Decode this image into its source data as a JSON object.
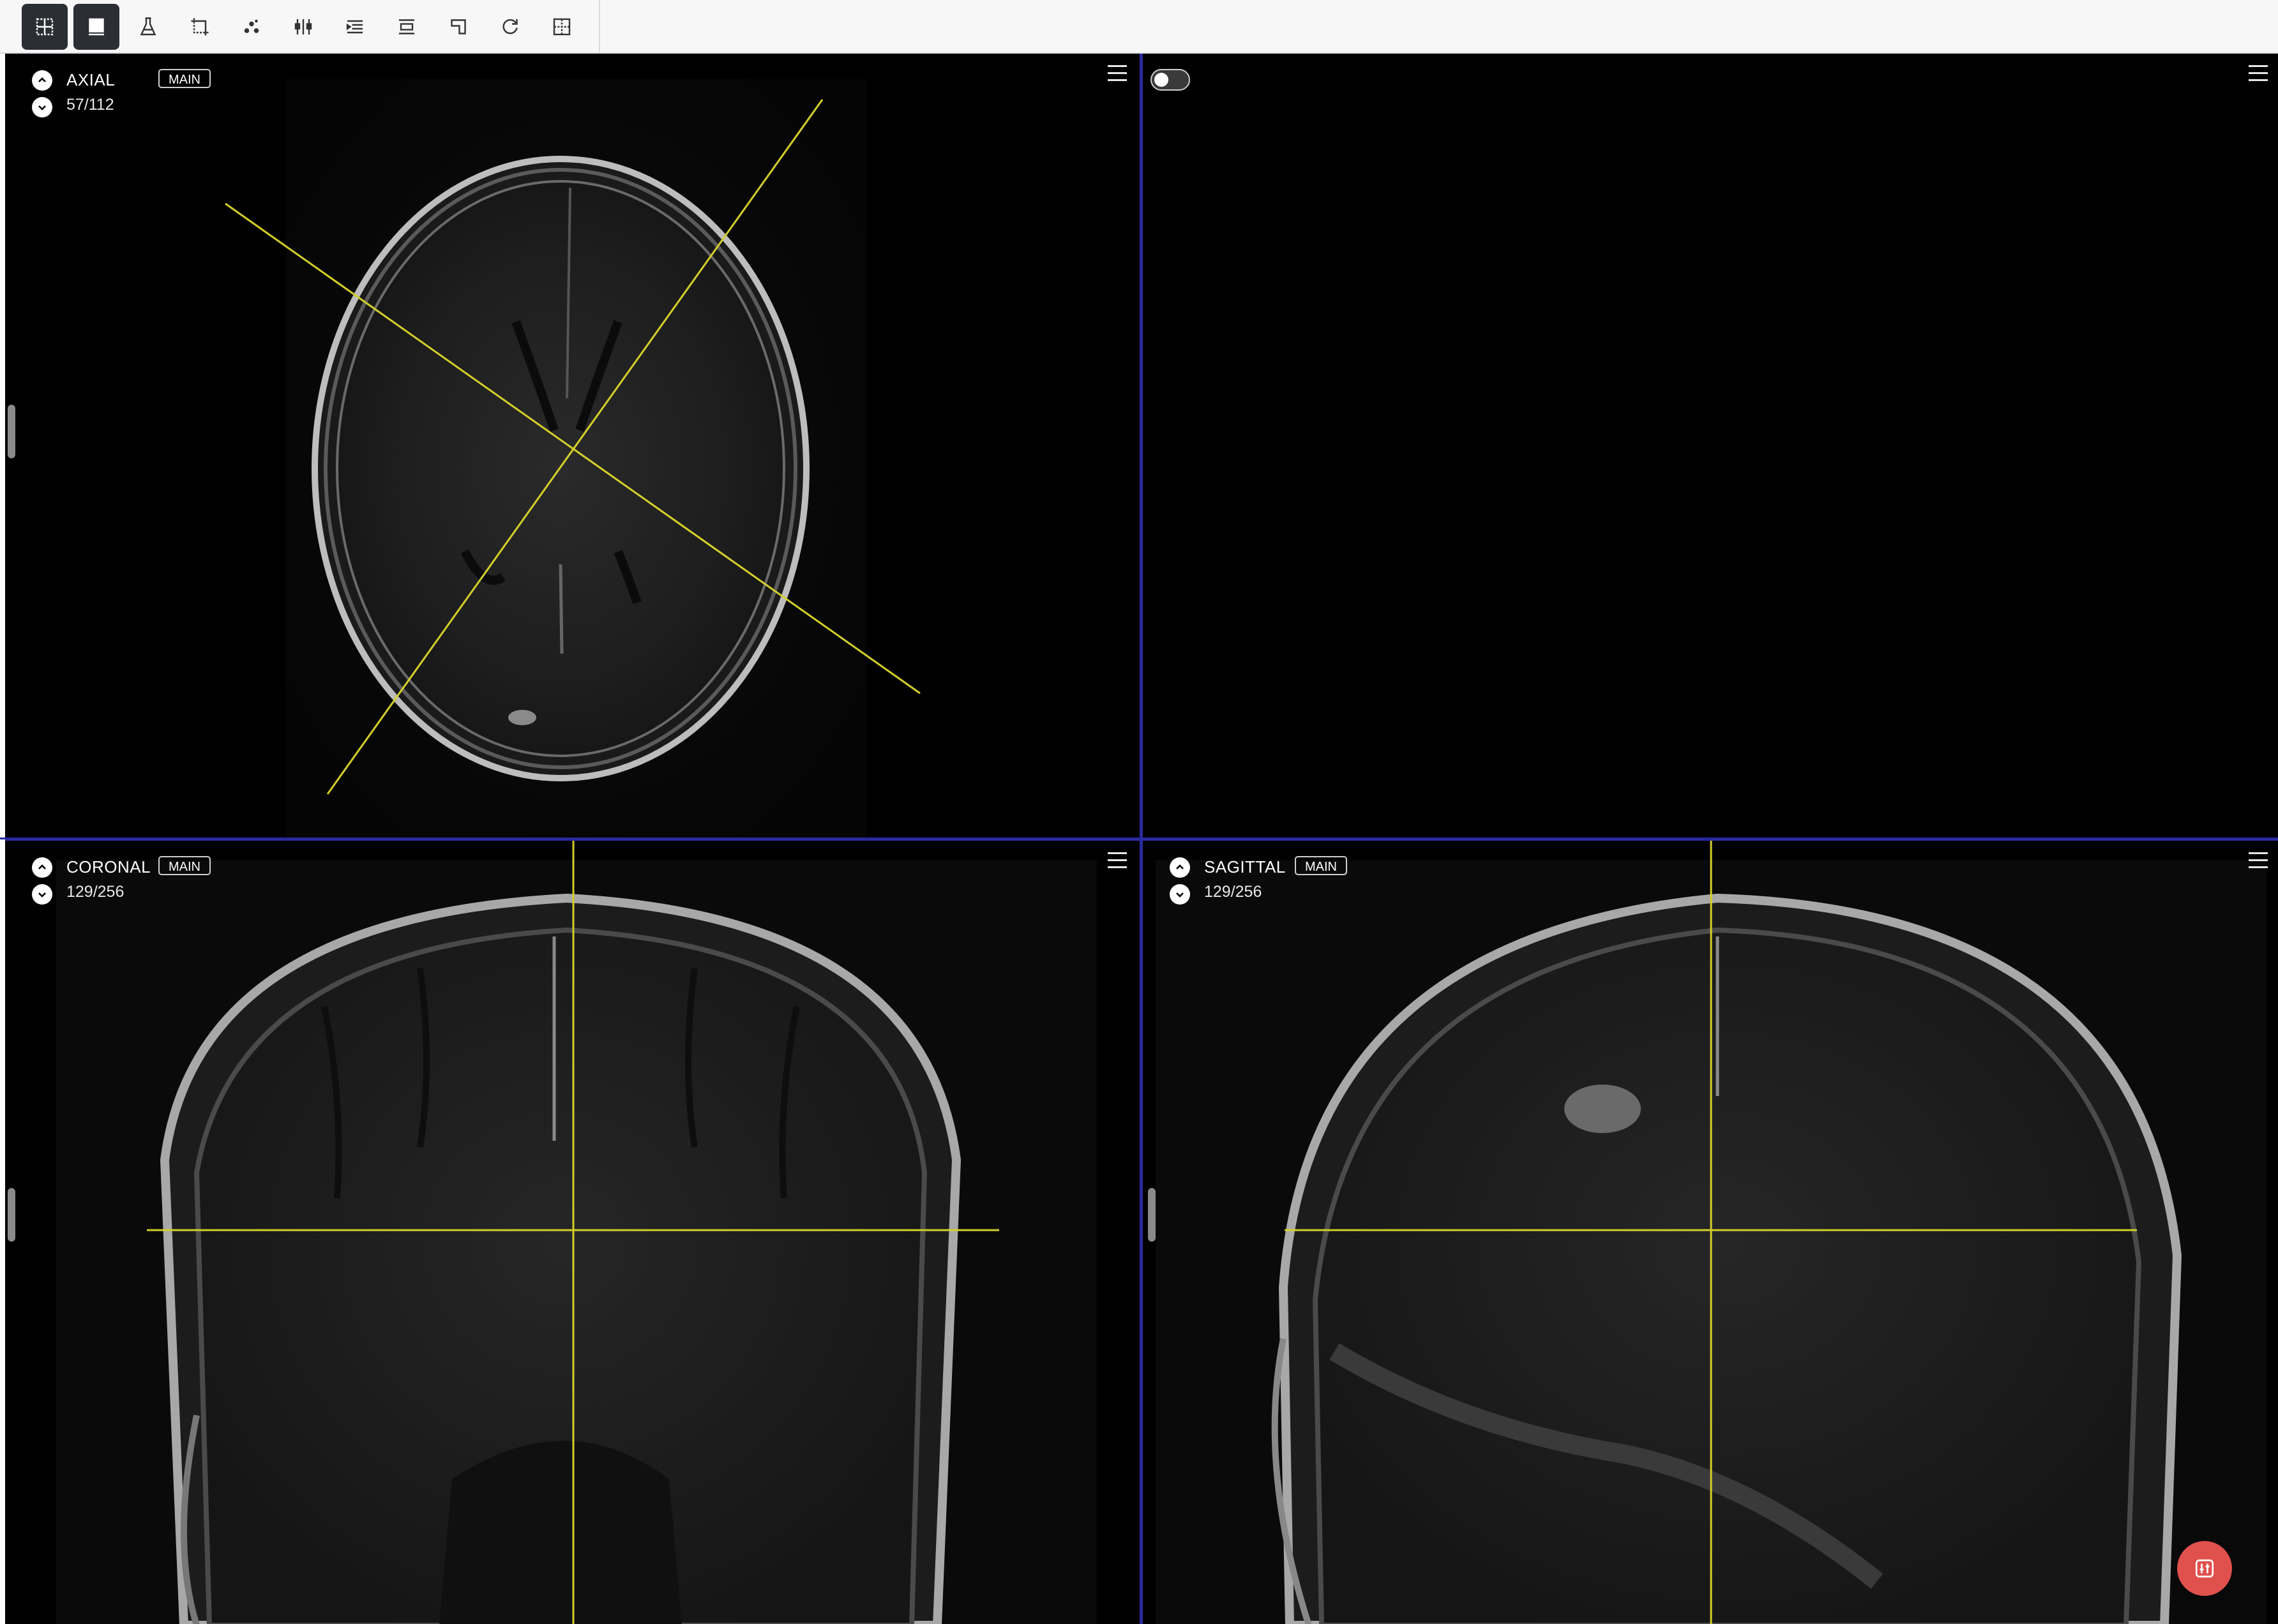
{
  "toolbar": {
    "tools": [
      {
        "id": "layout",
        "icon": "layout-grid-icon",
        "active": true
      },
      {
        "id": "window",
        "icon": "window-level-icon",
        "active": true
      },
      {
        "id": "flask",
        "icon": "flask-icon",
        "active": false
      },
      {
        "id": "crop",
        "icon": "crop-icon",
        "active": false
      },
      {
        "id": "points",
        "icon": "points-icon",
        "active": false
      },
      {
        "id": "sliders",
        "icon": "sliders-icon",
        "active": false
      },
      {
        "id": "align-left",
        "icon": "align-left-icon",
        "active": false
      },
      {
        "id": "align-center",
        "icon": "align-center-icon",
        "active": false
      },
      {
        "id": "corner",
        "icon": "corner-icon",
        "active": false
      },
      {
        "id": "rotate",
        "icon": "rotate-icon",
        "active": false
      },
      {
        "id": "frame",
        "icon": "frame-icon",
        "active": false
      }
    ]
  },
  "viewports": {
    "axial": {
      "label": "AXIAL",
      "badge": "MAIN",
      "slice": "57/112"
    },
    "coronal": {
      "label": "CORONAL",
      "badge": "MAIN",
      "slice": "129/256"
    },
    "sagittal": {
      "label": "SAGITTAL",
      "badge": "MAIN",
      "slice": "129/256"
    },
    "empty": {
      "toggle_on": false
    }
  },
  "colors": {
    "crosshair": "#d4cf2a",
    "divider": "#2a2aa0",
    "fab": "#e0504d"
  }
}
